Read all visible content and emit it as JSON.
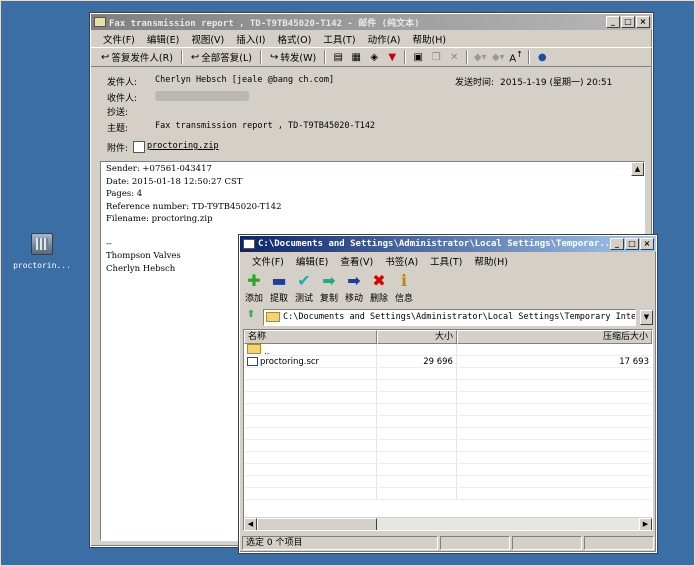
{
  "desktop": {
    "icon_label": "proctorin..."
  },
  "mail": {
    "title": "Fax transmission report , TD-T9TB45020-T142 - 邮件 (纯文本)",
    "menu": [
      "文件(F)",
      "编辑(E)",
      "视图(V)",
      "插入(I)",
      "格式(O)",
      "工具(T)",
      "动作(A)",
      "帮助(H)"
    ],
    "toolbar": {
      "reply": "答复发件人(R)",
      "reply_all": "全部答复(L)",
      "forward": "转发(W)"
    },
    "header": {
      "from_label": "发件人:",
      "from_value": "Cherlyn Hebsch [jeale    @bang    ch.com]",
      "to_label": "收件人:",
      "cc_label": "抄送:",
      "subject_label": "主题:",
      "subject_value": "Fax transmission report , TD-T9TB45020-T142",
      "attach_label": "附件:",
      "attach_value": "proctoring.zip",
      "sent_label": "发送时间:",
      "sent_value": "2015-1-19 (星期一) 20:51"
    },
    "body": [
      "Sender: +07561-043417",
      "Date: 2015-01-18 12:50:27 CST",
      "Pages: 4",
      "Reference number: TD-T9TB45020-T142",
      "Filename: proctoring.zip",
      "",
      "--",
      "Thompson Valves",
      "Cherlyn Hebsch"
    ]
  },
  "zip": {
    "title": "C:\\Documents and Settings\\Administrator\\Local Settings\\Temporar...",
    "menu": [
      "文件(F)",
      "编辑(E)",
      "查看(V)",
      "书签(A)",
      "工具(T)",
      "帮助(H)"
    ],
    "tools": [
      "添加",
      "提取",
      "测试",
      "复制",
      "移动",
      "删除",
      "信息"
    ],
    "path": "C:\\Documents and Settings\\Administrator\\Local Settings\\Temporary Internet F",
    "columns": {
      "name": "名称",
      "size": "大小",
      "packed": "压缩后大小"
    },
    "rows": [
      {
        "name": "..",
        "size": "",
        "packed": ""
      },
      {
        "name": "proctoring.scr",
        "size": "29 696",
        "packed": "17 693"
      }
    ],
    "status": "选定 0 个项目"
  }
}
